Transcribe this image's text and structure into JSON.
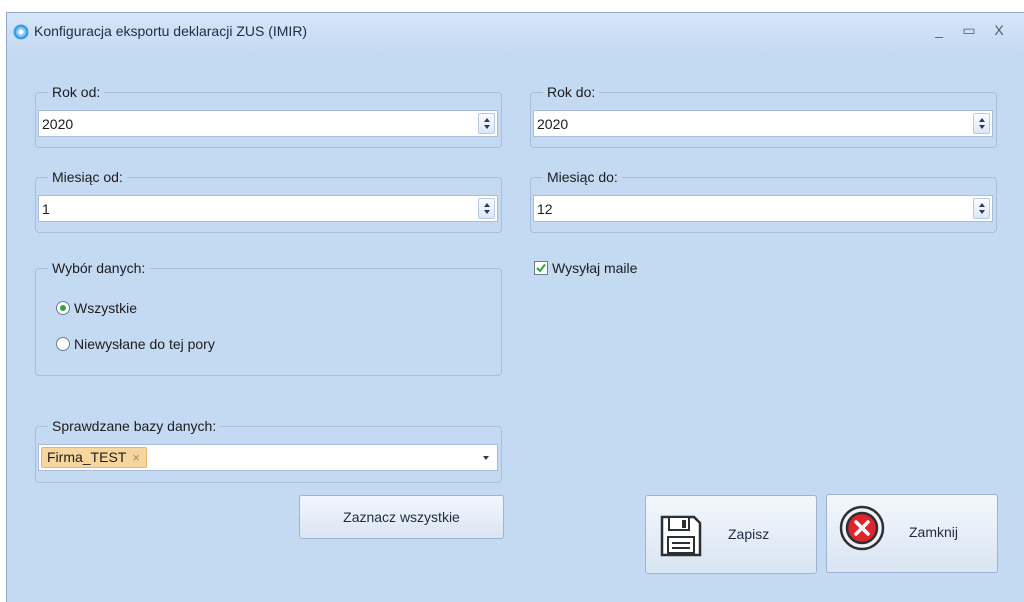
{
  "window": {
    "title": "Konfiguracja eksportu deklaracji ZUS (IMIR)",
    "minimize_glyph": "_",
    "maximize_glyph": "▭",
    "close_glyph": "X"
  },
  "year_from": {
    "label": "Rok od:",
    "value": "2020"
  },
  "year_to": {
    "label": "Rok do:",
    "value": "2020"
  },
  "month_from": {
    "label": "Miesiąc od:",
    "value": "1"
  },
  "month_to": {
    "label": "Miesiąc do:",
    "value": "12"
  },
  "data_choice": {
    "label": "Wybór danych:",
    "options": [
      {
        "label": "Wszystkie",
        "selected": true
      },
      {
        "label": "Niewysłane do tej pory",
        "selected": false
      }
    ]
  },
  "send_emails": {
    "label": "Wysyłaj maile",
    "checked": true
  },
  "databases": {
    "label": "Sprawdzane bazy danych:",
    "selected_tags": [
      "Firma_TEST"
    ],
    "tag_remove_glyph": "×"
  },
  "buttons": {
    "select_all": "Zaznacz wszystkie",
    "save": "Zapisz",
    "close": "Zamknij"
  },
  "icons": {
    "app": "gear-icon",
    "save": "floppy-disk-icon",
    "close": "red-x-circle-icon"
  },
  "colors": {
    "background": "#c4d9f2",
    "radio_selected": "#2ea43a",
    "checkbox_check": "#2ea43a",
    "tag_fill": "#f7d69e",
    "close_icon": "#e0242c"
  }
}
